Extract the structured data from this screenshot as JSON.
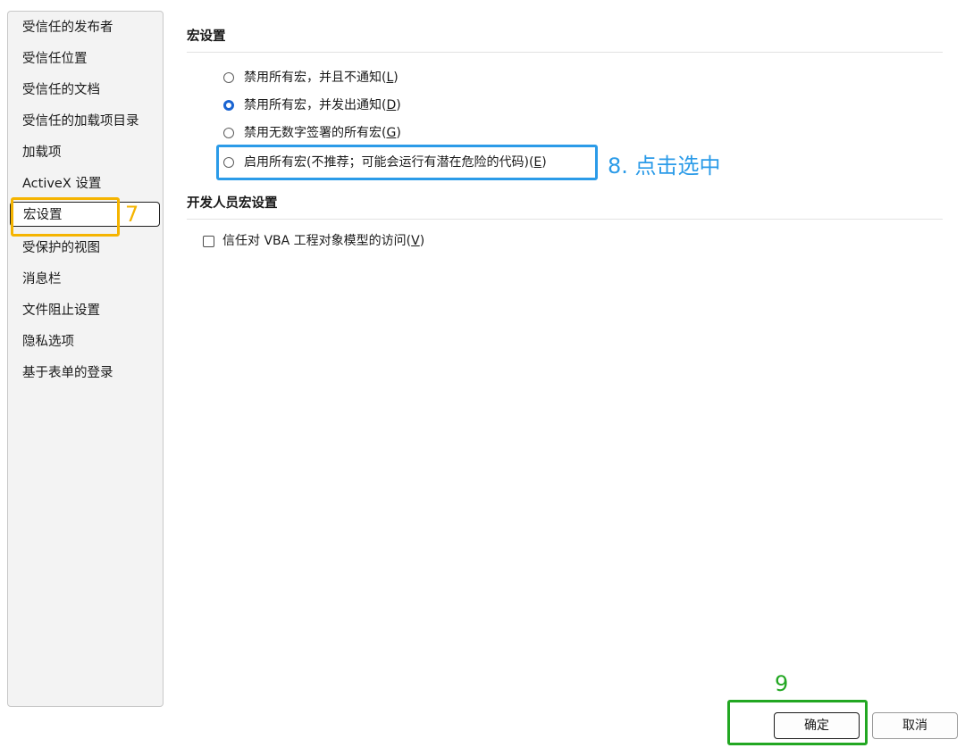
{
  "sidebar": {
    "items": [
      {
        "label": "受信任的发布者"
      },
      {
        "label": "受信任位置"
      },
      {
        "label": "受信任的文档"
      },
      {
        "label": "受信任的加载项目录"
      },
      {
        "label": "加载项"
      },
      {
        "label": "ActiveX 设置"
      },
      {
        "label": "宏设置",
        "selected": true
      },
      {
        "label": "受保护的视图"
      },
      {
        "label": "消息栏"
      },
      {
        "label": "文件阻止设置"
      },
      {
        "label": "隐私选项"
      },
      {
        "label": "基于表单的登录"
      }
    ]
  },
  "macro_section": {
    "title": "宏设置",
    "options": [
      {
        "label": "禁用所有宏，并且不通知",
        "key": "L",
        "checked": false
      },
      {
        "label": "禁用所有宏，并发出通知",
        "key": "D",
        "checked": true
      },
      {
        "label": "禁用无数字签署的所有宏",
        "key": "G",
        "checked": false
      },
      {
        "label": "启用所有宏(不推荐；可能会运行有潜在危险的代码)",
        "key": "E",
        "checked": false
      }
    ]
  },
  "developer_section": {
    "title": "开发人员宏设置",
    "checkbox": {
      "label": "信任对 VBA 工程对象模型的访问",
      "key": "V",
      "checked": false
    }
  },
  "annotations": {
    "step7": "7",
    "step8": "8. 点击选中",
    "step9": "9",
    "colors": {
      "step7": "#f5b400",
      "step8": "#2b9be8",
      "step9": "#22a722"
    }
  },
  "buttons": {
    "ok": "确定",
    "cancel": "取消"
  }
}
